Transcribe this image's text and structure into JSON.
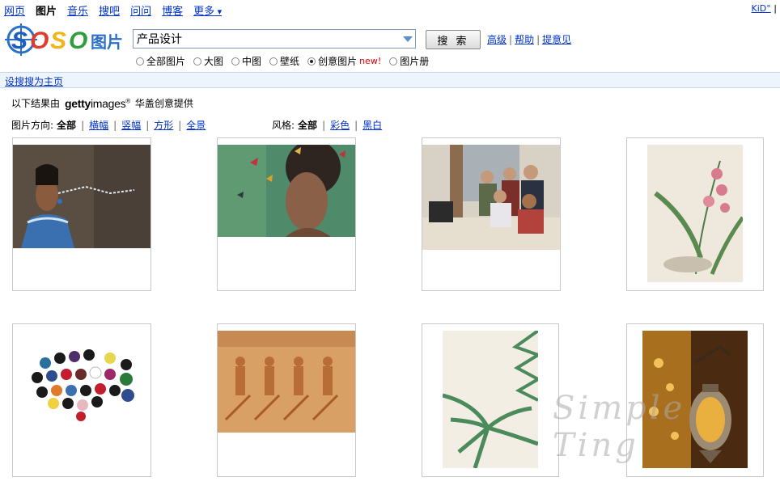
{
  "topnav": {
    "items": [
      "网页",
      "图片",
      "音乐",
      "搜吧",
      "问问",
      "博客",
      "更多"
    ],
    "active_index": 1
  },
  "user": {
    "name": "KiD°",
    "sep": "|"
  },
  "logo": {
    "text": "SOSO",
    "subtitle": "图片"
  },
  "search": {
    "value": "产品设计",
    "button_label": "搜 索"
  },
  "links": {
    "advanced": "高级",
    "help": "帮助",
    "feedback": "提意见"
  },
  "size_options": {
    "items": [
      "全部图片",
      "大图",
      "中图",
      "壁纸",
      "创意图片",
      "图片册"
    ],
    "selected_index": 4,
    "new_badge": "new!"
  },
  "homepage_link": "设搜搜为主页",
  "provider": {
    "prefix": "以下结果由",
    "brand_bold": "getty",
    "brand_rest": "images",
    "reg": "®",
    "suffix": "华盖创意提供"
  },
  "orientation": {
    "label": "图片方向:",
    "current": "全部",
    "options": [
      "横幅",
      "竖幅",
      "方形",
      "全景"
    ]
  },
  "style": {
    "label": "风格:",
    "current": "全部",
    "options": [
      "彩色",
      "黑白"
    ]
  },
  "images": [
    {
      "desc": "woman-spraying-water",
      "colors": [
        "#5a4e43",
        "#3a6fb0"
      ]
    },
    {
      "desc": "woman-with-butterflies-hair",
      "colors": [
        "#4f8a6a",
        "#2e2420"
      ]
    },
    {
      "desc": "office-team-meeting",
      "colors": [
        "#8c6c4e",
        "#d8d2c6"
      ]
    },
    {
      "desc": "botanical-lily-illustration",
      "colors": [
        "#efe8dc",
        "#d77b8d"
      ]
    },
    {
      "desc": "colorful-buttons",
      "colors": [
        "#ffffff",
        "#c21e2e"
      ]
    },
    {
      "desc": "egyptian-relief-wall",
      "colors": [
        "#d9a066",
        "#b86d36"
      ]
    },
    {
      "desc": "palm-leaves-illustration",
      "colors": [
        "#f3eee3",
        "#4b8a5a"
      ]
    },
    {
      "desc": "moroccan-lantern",
      "colors": [
        "#4a2a10",
        "#e9b040"
      ]
    }
  ],
  "watermark": "Simple Ting"
}
